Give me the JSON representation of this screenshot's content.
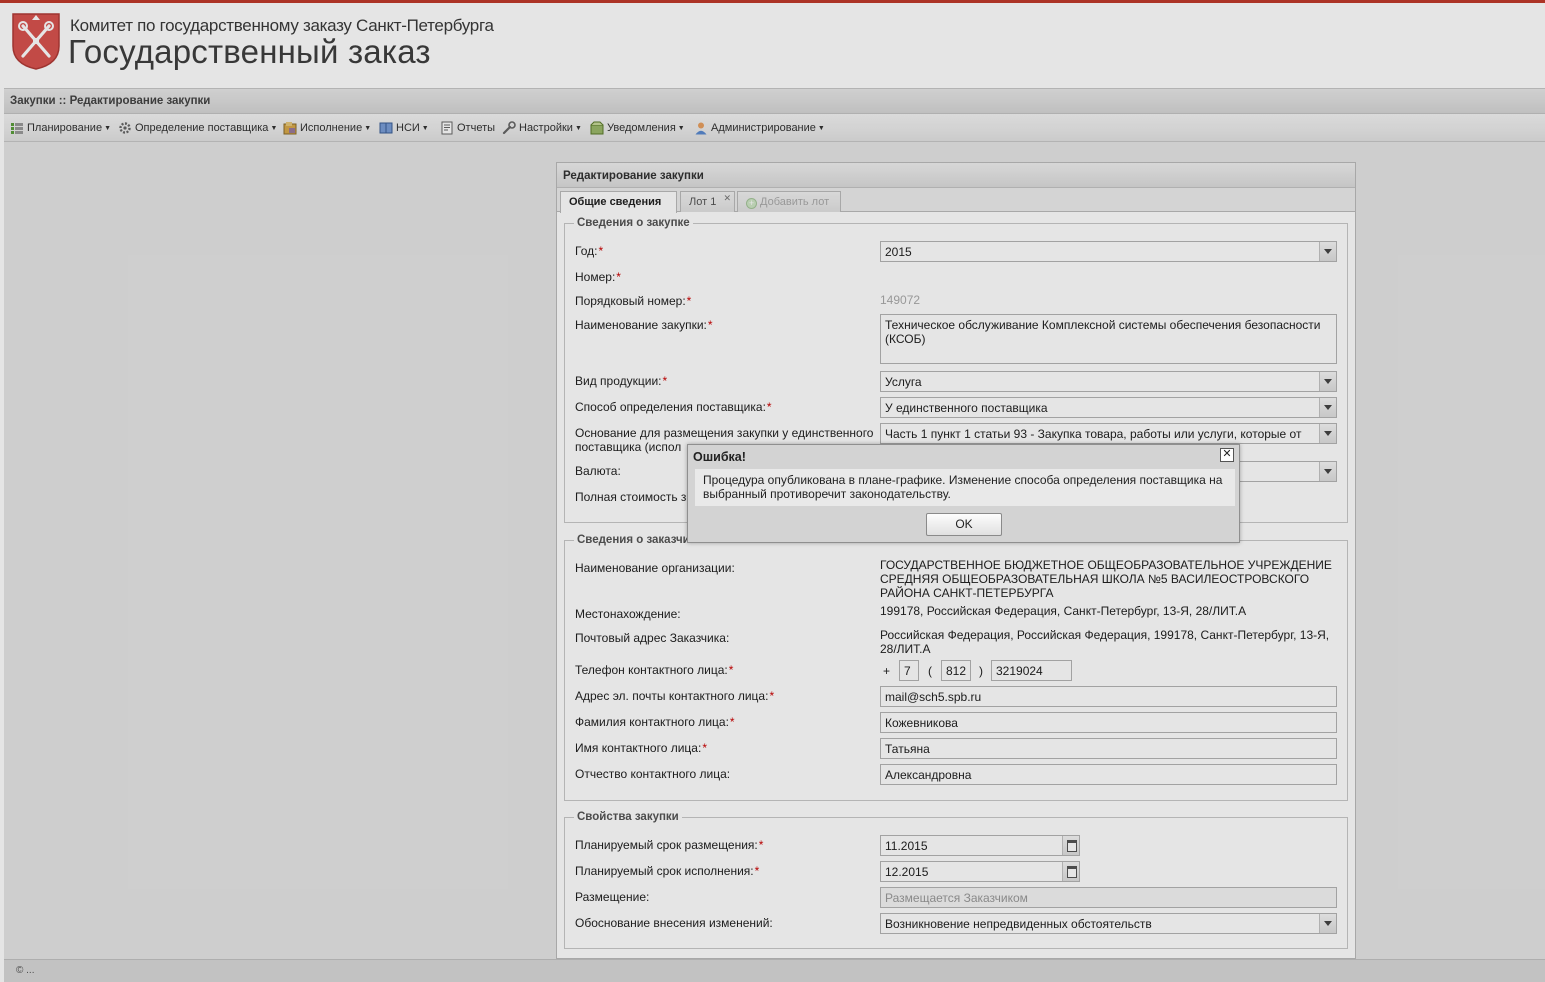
{
  "header": {
    "subtitle": "Комитет по государственному заказу Санкт-Петербурга",
    "title": "Государственный заказ"
  },
  "breadcrumb": "Закупки :: Редактирование закупки",
  "menu": [
    {
      "label": "Планирование",
      "icon": "planning-icon"
    },
    {
      "label": "Определение поставщика",
      "icon": "gear-icon"
    },
    {
      "label": "Исполнение",
      "icon": "execution-icon"
    },
    {
      "label": "НСИ",
      "icon": "book-icon"
    },
    {
      "label": "Отчеты",
      "icon": "report-icon"
    },
    {
      "label": "Настройки",
      "icon": "wrench-icon"
    },
    {
      "label": "Уведомления",
      "icon": "notification-icon"
    },
    {
      "label": "Администрирование",
      "icon": "user-icon"
    }
  ],
  "panel": {
    "title": "Редактирование закупки",
    "tabs": {
      "general": "Общие сведения",
      "lot1": "Лот 1",
      "add_lot": "Добавить лот"
    }
  },
  "procurement": {
    "legend": "Сведения о закупке",
    "year_label": "Год:",
    "year_value": "2015",
    "number_label": "Номер:",
    "seq_label": "Порядковый номер:",
    "seq_value": "149072",
    "name_label": "Наименование закупки:",
    "name_value": "Техническое обслуживание Комплексной системы обеспечения безопасности (КСОБ)",
    "product_label": "Вид продукции:",
    "product_value": "Услуга",
    "method_label": "Способ определения поставщика:",
    "method_value": "У единственного поставщика",
    "basis_label": "Основание для размещения закупки у единственного поставщика (испол",
    "basis_value": "Часть 1 пункт 1 статьи 93 -  Закупка товара, работы или услуги, которые от",
    "currency_label": "Валюта:",
    "total_label": "Полная стоимость з"
  },
  "customer": {
    "legend": "Сведения о заказчике",
    "org_label": "Наименование организации:",
    "org_value": "ГОСУДАРСТВЕННОЕ БЮДЖЕТНОЕ ОБЩЕОБРАЗОВАТЕЛЬНОЕ УЧРЕЖДЕНИЕ СРЕДНЯЯ ОБЩЕОБРАЗОВАТЕЛЬНАЯ ШКОЛА №5 ВАСИЛЕОСТРОВСКОГО РАЙОНА САНКТ-ПЕТЕРБУРГА",
    "location_label": "Местонахождение:",
    "location_value": "199178, Российская Федерация, Санкт-Петербург, 13-Я, 28/ЛИТ.А",
    "postal_label": "Почтовый адрес Заказчика:",
    "postal_value": "Российская Федерация, Российская Федерация, 199178, Санкт-Петербург, 13-Я, 28/ЛИТ.А",
    "phone_label": "Телефон контактного лица:",
    "phone_country": "7",
    "phone_code": "812",
    "phone_number": "3219024",
    "email_label": "Адрес эл. почты контактного лица:",
    "email_value": "mail@sch5.spb.ru",
    "lastname_label": "Фамилия контактного лица:",
    "lastname_value": "Кожевникова",
    "firstname_label": "Имя контактного лица:",
    "firstname_value": "Татьяна",
    "patronymic_label": "Отчество контактного лица:",
    "patronymic_value": "Александровна"
  },
  "properties": {
    "legend": "Свойства закупки",
    "placement_date_label": "Планируемый срок размещения:",
    "placement_date_value": "11.2015",
    "execution_date_label": "Планируемый срок исполнения:",
    "execution_date_value": "12.2015",
    "placement_label": "Размещение:",
    "placement_value": "Размещается Заказчиком",
    "reason_label": "Обоснование внесения изменений:",
    "reason_value": "Возникновение непредвиденных обстоятельств"
  },
  "dialog": {
    "title": "Ошибка!",
    "message": "Процедура опубликована в плане-графике. Изменение способа определения поставщика на выбранный противоречит законодательству.",
    "ok_label": "OK"
  },
  "footer": "© ..."
}
